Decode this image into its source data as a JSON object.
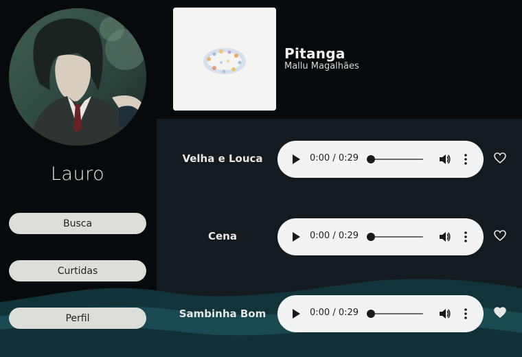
{
  "user": {
    "name": "Lauro"
  },
  "nav": {
    "items": [
      {
        "label": "Busca"
      },
      {
        "label": "Curtidas"
      },
      {
        "label": "Perfil"
      }
    ]
  },
  "album": {
    "title": "Pitanga",
    "artist": "Mallu Magalhães"
  },
  "tracks": [
    {
      "name": "Velha e Louca",
      "time": "0:00 / 0:29",
      "liked": false
    },
    {
      "name": "Cena",
      "time": "0:00 / 0:29",
      "liked": false
    },
    {
      "name": "Sambinha Bom",
      "time": "0:00 / 0:29",
      "liked": true
    }
  ],
  "colors": {
    "background": "#070a0c",
    "panel": "#141b20",
    "nav_button": "#dcdfd9",
    "player": "#f1f3f4",
    "wave": "#1d4e57",
    "text": "#e6e6e6"
  },
  "icons": {
    "play": "play-icon",
    "volume": "volume-icon",
    "more": "more-vertical-icon",
    "heart_outline": "heart-outline-icon",
    "heart_filled": "heart-filled-icon"
  }
}
